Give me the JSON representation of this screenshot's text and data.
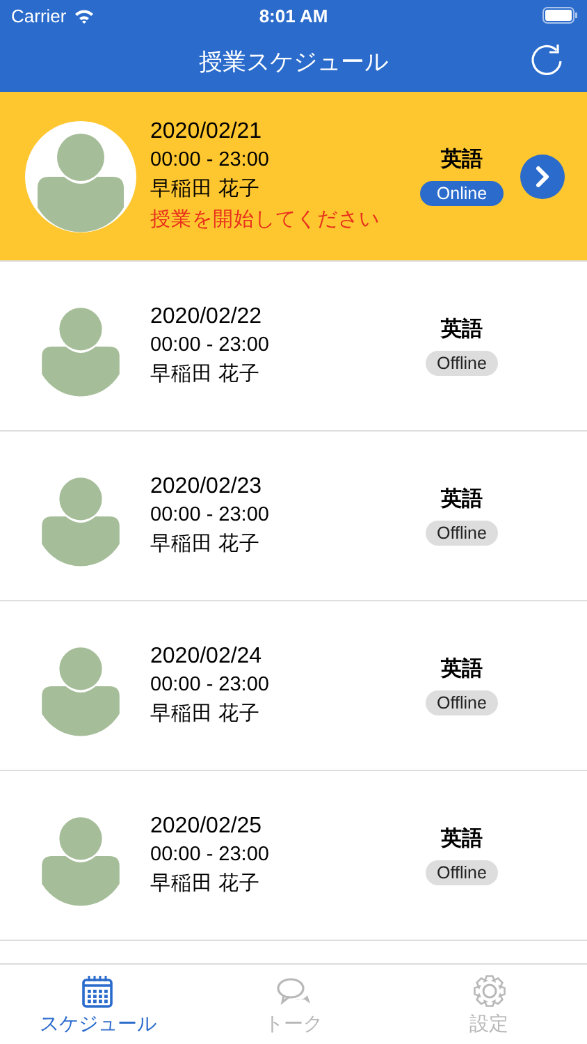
{
  "status_bar": {
    "carrier": "Carrier",
    "time": "8:01 AM"
  },
  "nav": {
    "title": "授業スケジュール"
  },
  "lessons": [
    {
      "date": "2020/02/21",
      "time": "00:00 - 23:00",
      "teacher": "早稲田 花子",
      "notice": "授業を開始してください",
      "subject": "英語",
      "status": "Online",
      "online": true,
      "selected": true
    },
    {
      "date": "2020/02/22",
      "time": "00:00 - 23:00",
      "teacher": "早稲田 花子",
      "subject": "英語",
      "status": "Offline",
      "online": false,
      "selected": false
    },
    {
      "date": "2020/02/23",
      "time": "00:00 - 23:00",
      "teacher": "早稲田 花子",
      "subject": "英語",
      "status": "Offline",
      "online": false,
      "selected": false
    },
    {
      "date": "2020/02/24",
      "time": "00:00 - 23:00",
      "teacher": "早稲田 花子",
      "subject": "英語",
      "status": "Offline",
      "online": false,
      "selected": false
    },
    {
      "date": "2020/02/25",
      "time": "00:00 - 23:00",
      "teacher": "早稲田 花子",
      "subject": "英語",
      "status": "Offline",
      "online": false,
      "selected": false
    }
  ],
  "tabs": [
    {
      "kind": "calendar",
      "label": "スケジュール",
      "selected": true
    },
    {
      "kind": "chat",
      "label": "トーク",
      "selected": false
    },
    {
      "kind": "gear",
      "label": "設定",
      "selected": false
    }
  ]
}
